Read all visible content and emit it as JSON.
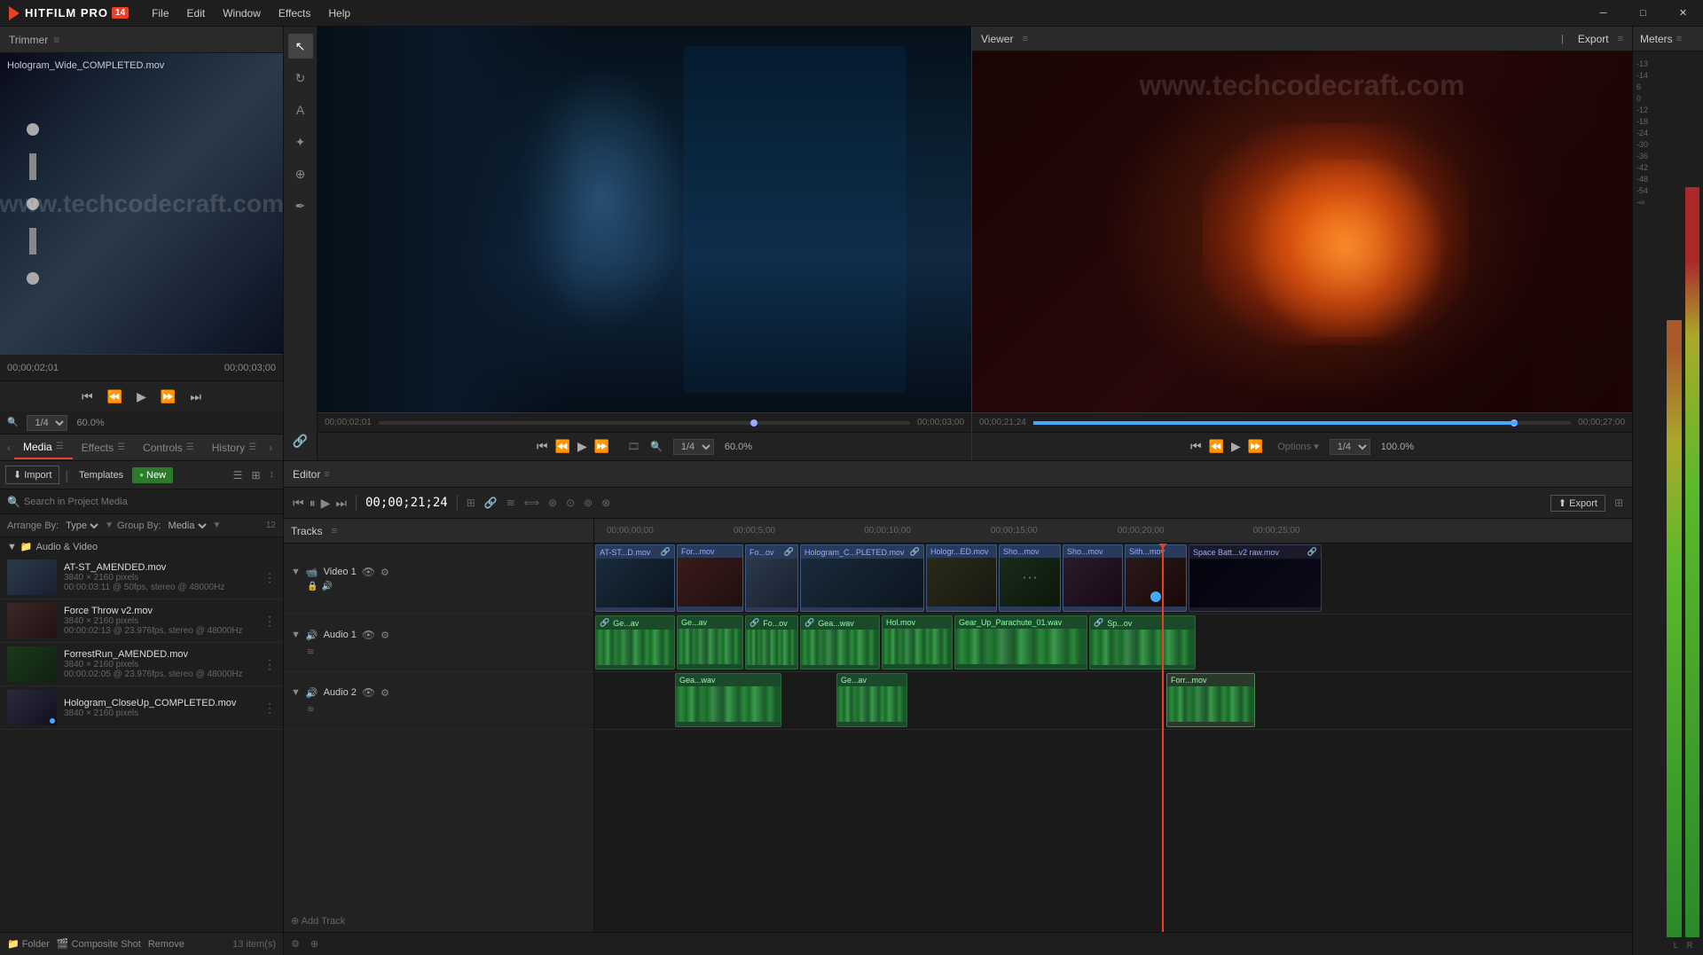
{
  "app": {
    "name": "HITFILM PRO",
    "version": "14",
    "title": "HitFilm Pro"
  },
  "titlebar": {
    "menu": [
      "File",
      "Edit",
      "Window",
      "Effects",
      "Help"
    ],
    "window_controls": [
      "minimize",
      "maximize",
      "close"
    ]
  },
  "trimmer": {
    "title": "Trimmer",
    "filename": "Hologram_Wide_COMPLETED.mov",
    "time_start": "00;00;02;01",
    "time_end": "00;00;03;00",
    "zoom": "60.0%",
    "zoom_fraction": "1/4"
  },
  "media_panel": {
    "tabs": [
      {
        "label": "Media",
        "active": true
      },
      {
        "label": "Effects",
        "active": false
      },
      {
        "label": "Controls",
        "active": false
      },
      {
        "label": "History",
        "active": false
      }
    ],
    "toolbar": {
      "import_label": "Import",
      "templates_label": "Templates",
      "new_label": "New"
    },
    "search_placeholder": "Search in Project Media",
    "sort": {
      "arrange_label": "Arrange By:",
      "arrange_value": "Type",
      "group_label": "Group By:",
      "group_value": "Media"
    },
    "items": [
      {
        "group": "Audio & Video",
        "files": [
          {
            "name": "AT-ST_AMENDED.mov",
            "meta1": "3840 × 2160 pixels",
            "meta2": "00:00:03:11 @ 50fps, stereo @ 48000Hz"
          },
          {
            "name": "Force Throw v2.mov",
            "meta1": "3840 × 2160 pixels",
            "meta2": "00:00:02:13 @ 23.976fps, stereo @ 48000Hz"
          },
          {
            "name": "ForrestRun_AMENDED.mov",
            "meta1": "3840 × 2160 pixels",
            "meta2": "00:00:02:05 @ 23.976fps, stereo @ 48000Hz"
          },
          {
            "name": "Hologram_CloseUp_COMPLETED.mov",
            "meta1": "3840 × 2160 pixels",
            "meta2": ""
          }
        ]
      }
    ],
    "footer": {
      "folder_label": "Folder",
      "composite_shot_label": "Composite Shot",
      "remove_label": "Remove",
      "item_count": "13 item(s)"
    }
  },
  "viewer": {
    "title": "Viewer",
    "time": "00;00;21;24",
    "zoom": "100.0%",
    "zoom_fraction": "1/4"
  },
  "export": {
    "title": "Export"
  },
  "editor": {
    "title": "Editor",
    "time": "00;00;21;24",
    "tracks_label": "Tracks",
    "export_label": "Export",
    "ruler_times": [
      "00;00;5;00",
      "00;00;10;00",
      "00;00;15;00",
      "00;00;20;00",
      "00;00;25;00"
    ]
  },
  "timeline": {
    "video_track": {
      "label": "Video 1",
      "clips": [
        {
          "name": "AT-ST...D.mov",
          "link": true
        },
        {
          "name": "For...mov",
          "link": false
        },
        {
          "name": "Fo...ov",
          "link": true
        },
        {
          "name": "Hologram_C...PLETED.mov",
          "link": true
        },
        {
          "name": "Hologr...ED.mov",
          "link": false
        },
        {
          "name": "Sho...mov",
          "link": false
        },
        {
          "name": "Sho...mov",
          "link": false
        },
        {
          "name": "Sith...mov",
          "link": false
        },
        {
          "name": "Space Batt...v2 raw.mov",
          "link": true
        }
      ]
    },
    "audio_tracks": [
      {
        "label": "Audio 1",
        "clips": [
          {
            "name": "Ge...av",
            "link": true
          },
          {
            "name": "Ge...av",
            "link": false
          },
          {
            "name": "Fo...ov",
            "link": true
          },
          {
            "name": "Gea...wav",
            "link": true
          },
          {
            "name": "Hol.mov",
            "link": false
          },
          {
            "name": "Gear_Up_Parachute_01.wav",
            "link": false
          },
          {
            "name": "Sp...ov",
            "link": true
          }
        ]
      },
      {
        "label": "Audio 2",
        "clips": [
          {
            "name": "Gea...wav",
            "link": false
          },
          {
            "name": "Ge...av",
            "link": false
          },
          {
            "name": "Forr...mov",
            "link": false
          }
        ]
      }
    ]
  },
  "meters": {
    "title": "Meters",
    "scale": [
      "-13",
      "-14",
      "6",
      "0",
      "-12",
      "-18",
      "-24",
      "-30",
      "-36",
      "-42",
      "-48",
      "-54",
      "-00"
    ],
    "labels": [
      "L",
      "R"
    ]
  },
  "tools": [
    "pointer",
    "orbit",
    "text",
    "crosshair",
    "pen",
    "camera"
  ]
}
